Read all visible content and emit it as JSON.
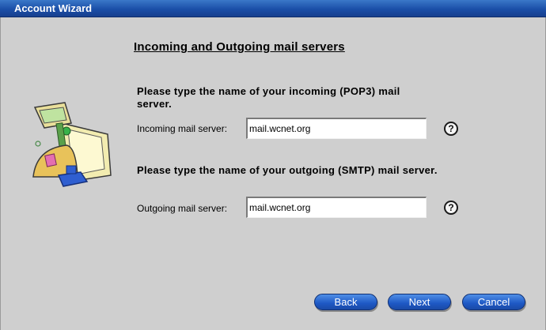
{
  "window": {
    "title": "Account Wizard"
  },
  "page": {
    "heading": "Incoming and Outgoing mail servers",
    "incoming": {
      "prompt": "Please type the name of your incoming (POP3) mail server.",
      "label": "Incoming mail server:",
      "value": "mail.wcnet.org"
    },
    "outgoing": {
      "prompt": "Please type the name of your outgoing (SMTP) mail server.",
      "label": "Outgoing mail server:",
      "value": "mail.wcnet.org"
    },
    "help_glyph": "?"
  },
  "buttons": {
    "back": "Back",
    "next": "Next",
    "cancel": "Cancel"
  },
  "colors": {
    "titlebar": "#1b4fa8",
    "button": "#1e58c4",
    "background": "#cfcfcf"
  }
}
